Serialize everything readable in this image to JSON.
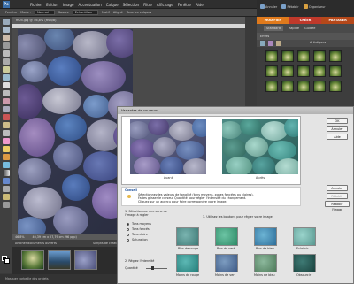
{
  "menubar": {
    "items": [
      "Fichier",
      "Edition",
      "Image",
      "Accentuation",
      "Calque",
      "Sélection",
      "Filtre",
      "Affichage",
      "Fenêtre",
      "Aide"
    ]
  },
  "optionsbar": {
    "label1": "Fenêtre",
    "mode_label": "Mode :",
    "mode_value": "Normal",
    "source_label": "Source",
    "source_value": "Echantillon",
    "sample_label": "Motif",
    "align_label": "Aligné",
    "all_layers_label": "Tous les calques"
  },
  "topright": {
    "cancel_label": "Annuler",
    "redo_label": "Rétablir",
    "organizer_label": "Organiseur"
  },
  "tabs": {
    "modify": "MODIFIER",
    "create": "CRÉER",
    "share": "PARTAGER"
  },
  "subtabs": {
    "standard": "Standard",
    "quick": "Rapide",
    "guided": "Guidée"
  },
  "document": {
    "title": "m05.jpg @ 46,8% (RVB/8)",
    "zoom": "46,8%",
    "size": "40,39 cm x 27,79 cm (96 ppp)"
  },
  "bins": {
    "title": "Afficher documents ouverts",
    "scripts": "Scripts de création"
  },
  "bottombar": {
    "text": "Masquer corbeille des projets"
  },
  "effects": {
    "header": "Effets",
    "type_label": "Artistiques"
  },
  "dialog": {
    "title": "Variantes de couleurs",
    "before_label": "Avant",
    "after_label": "Après",
    "ok_label": "OK",
    "cancel_label": "Annuler",
    "help_label": "Aide",
    "undo_label": "Annuler",
    "redo_label": "Rétablir",
    "reset_label": "Rétablir l'image",
    "tip_title": "Conseil",
    "tip_text_1": "Sélectionnez les valeurs de tonalité (tons moyens, zones foncées ou claires).",
    "tip_text_2": "Faites glisser le curseur Quantité pour régler l'intensité du changement.",
    "tip_text_3": "Cliquez sur un aperçu pour faire correspondre votre image.",
    "step1_title": "1. Sélectionnez une zone de l'image à régler",
    "options": [
      "Tons moyens",
      "Tons foncés",
      "Tons clairs",
      "Saturation"
    ],
    "step2_title": "2. Réglez l'intensité",
    "quantity_label": "Quantité",
    "step3_title": "3. Utilisez les boutons pour régler votre image",
    "variations": [
      "Plus de rouge",
      "Plus de vert",
      "Plus de bleu",
      "Eclaircir",
      "Moins de rouge",
      "Moins de vert",
      "Moins de bleu",
      "Obscurcir"
    ]
  }
}
